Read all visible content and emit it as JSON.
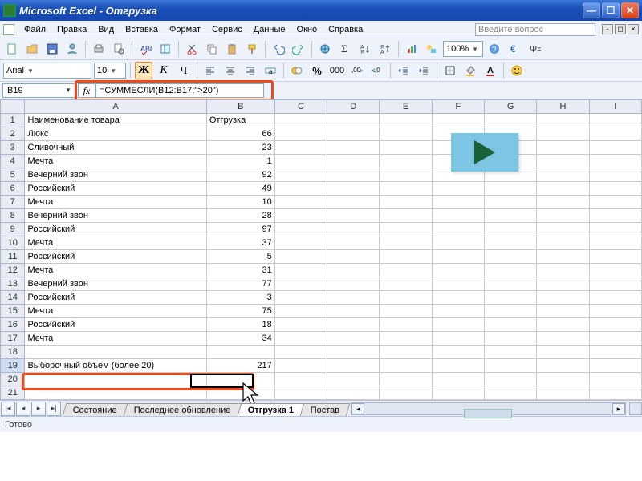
{
  "titlebar": {
    "title": "Microsoft Excel - Отгрузка"
  },
  "menu": {
    "items": [
      "Файл",
      "Правка",
      "Вид",
      "Вставка",
      "Формат",
      "Сервис",
      "Данные",
      "Окно",
      "Справка"
    ],
    "question_placeholder": "Введите вопрос"
  },
  "fontbar": {
    "font": "Arial",
    "size": "10",
    "bold": "Ж",
    "italic": "К",
    "underline": "Ч"
  },
  "toolbar": {
    "zoom": "100%",
    "currency_label": "%"
  },
  "formula": {
    "namebox": "B19",
    "fx": "fx",
    "text": "=СУММЕСЛИ(B12:B17;\">20\")"
  },
  "columns": [
    "A",
    "B",
    "C",
    "D",
    "E",
    "F",
    "G",
    "H",
    "I"
  ],
  "rows": [
    {
      "n": 1,
      "a": "Наименование товара",
      "b": "Отгрузка",
      "balign": "left"
    },
    {
      "n": 2,
      "a": "Люкс",
      "b": "66"
    },
    {
      "n": 3,
      "a": "Сливочный",
      "b": "23"
    },
    {
      "n": 4,
      "a": "Мечта",
      "b": "1"
    },
    {
      "n": 5,
      "a": "Вечерний звон",
      "b": "92"
    },
    {
      "n": 6,
      "a": "Российский",
      "b": "49"
    },
    {
      "n": 7,
      "a": "Мечта",
      "b": "10"
    },
    {
      "n": 8,
      "a": "Вечерний звон",
      "b": "28"
    },
    {
      "n": 9,
      "a": "Российский",
      "b": "97"
    },
    {
      "n": 10,
      "a": "Мечта",
      "b": "37"
    },
    {
      "n": 11,
      "a": "Российский",
      "b": "5"
    },
    {
      "n": 12,
      "a": "Мечта",
      "b": "31"
    },
    {
      "n": 13,
      "a": "Вечерний звон",
      "b": "77"
    },
    {
      "n": 14,
      "a": "Российский",
      "b": "3"
    },
    {
      "n": 15,
      "a": "Мечта",
      "b": "75"
    },
    {
      "n": 16,
      "a": "Российский",
      "b": "18"
    },
    {
      "n": 17,
      "a": "Мечта",
      "b": "34"
    },
    {
      "n": 18,
      "a": "",
      "b": ""
    },
    {
      "n": 19,
      "a": "Выборочный объем (более 20)",
      "b": "217"
    },
    {
      "n": 20,
      "a": "",
      "b": ""
    },
    {
      "n": 21,
      "a": "",
      "b": ""
    }
  ],
  "tabs": {
    "items": [
      "Состояние",
      "Последнее обновление",
      "Отгрузка 1",
      "Постав"
    ],
    "active_index": 2
  },
  "status": {
    "text": "Готово"
  },
  "chart_data": {
    "type": "table",
    "title": "Отгрузка",
    "columns": [
      "Наименование товара",
      "Отгрузка"
    ],
    "rows": [
      [
        "Люкс",
        66
      ],
      [
        "Сливочный",
        23
      ],
      [
        "Мечта",
        1
      ],
      [
        "Вечерний звон",
        92
      ],
      [
        "Российский",
        49
      ],
      [
        "Мечта",
        10
      ],
      [
        "Вечерний звон",
        28
      ],
      [
        "Российский",
        97
      ],
      [
        "Мечта",
        37
      ],
      [
        "Российский",
        5
      ],
      [
        "Мечта",
        31
      ],
      [
        "Вечерний звон",
        77
      ],
      [
        "Российский",
        3
      ],
      [
        "Мечта",
        75
      ],
      [
        "Российский",
        18
      ],
      [
        "Мечта",
        34
      ]
    ],
    "summary": {
      "label": "Выборочный объем (более 20)",
      "value": 217,
      "formula": "=СУММЕСЛИ(B12:B17;\">20\")"
    }
  }
}
